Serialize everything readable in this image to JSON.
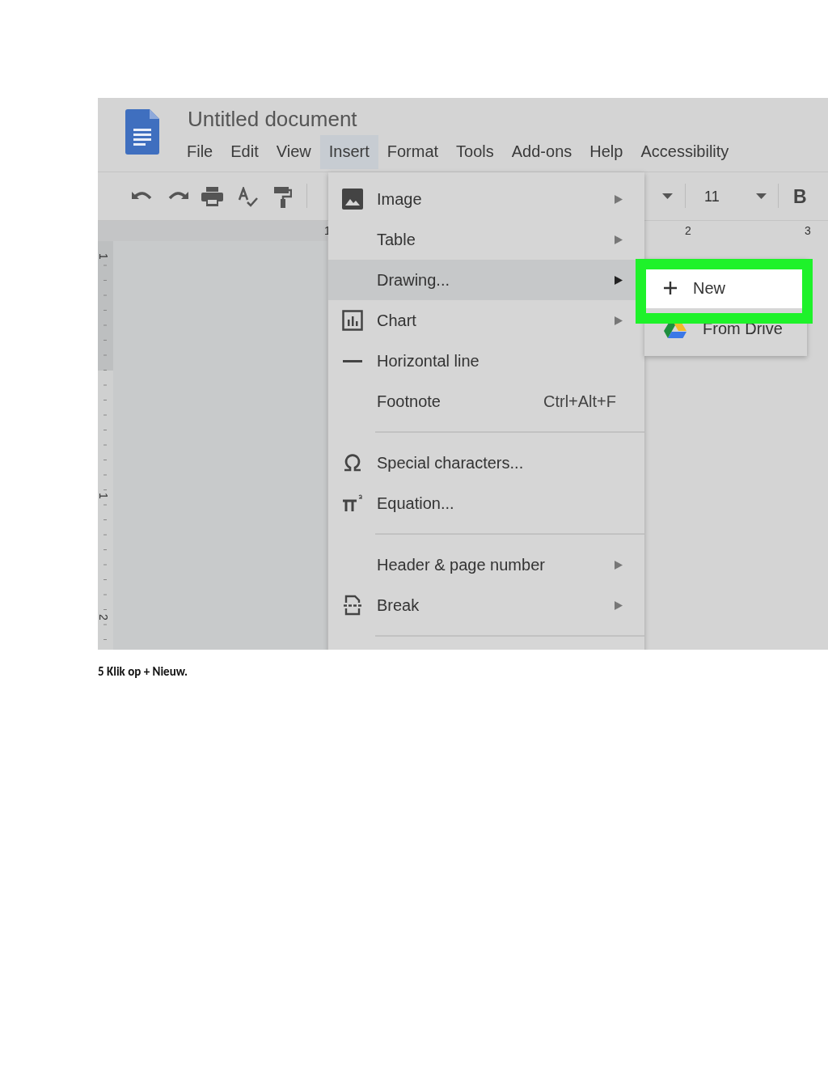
{
  "document_window": {
    "title": "Untitled document",
    "menu_bar": [
      {
        "label": "File",
        "selected": false
      },
      {
        "label": "Edit",
        "selected": false
      },
      {
        "label": "View",
        "selected": false
      },
      {
        "label": "Insert",
        "selected": true
      },
      {
        "label": "Format",
        "selected": false
      },
      {
        "label": "Tools",
        "selected": false
      },
      {
        "label": "Add-ons",
        "selected": false
      },
      {
        "label": "Help",
        "selected": false
      },
      {
        "label": "Accessibility",
        "selected": false
      }
    ],
    "toolbar": {
      "font_size": "11",
      "bold_label": "B"
    },
    "horizontal_ruler": [
      "1",
      "2",
      "3"
    ],
    "vertical_ruler": [
      "1",
      "1",
      "2"
    ],
    "insert_menu": [
      {
        "kind": "item",
        "label": "Image",
        "submenu": true,
        "selected": false
      },
      {
        "kind": "item",
        "label": "Table",
        "submenu": true,
        "selected": false
      },
      {
        "kind": "item",
        "label": "Drawing...",
        "submenu": true,
        "selected": true
      },
      {
        "kind": "item",
        "label": "Chart",
        "submenu": true,
        "selected": false
      },
      {
        "kind": "item",
        "label": "Horizontal line",
        "submenu": false,
        "selected": false
      },
      {
        "kind": "item",
        "label": "Footnote",
        "shortcut": "Ctrl+Alt+F",
        "submenu": false,
        "selected": false
      },
      {
        "kind": "separator"
      },
      {
        "kind": "item",
        "label": "Special characters...",
        "submenu": false,
        "selected": false
      },
      {
        "kind": "item",
        "label": "Equation...",
        "submenu": false,
        "selected": false
      },
      {
        "kind": "separator"
      },
      {
        "kind": "item",
        "label": "Header & page number",
        "submenu": true,
        "selected": false
      },
      {
        "kind": "item",
        "label": "Break",
        "submenu": true,
        "selected": false
      },
      {
        "kind": "separator"
      }
    ],
    "drawing_submenu": [
      {
        "label": "New",
        "selected": true,
        "highlighted": true
      },
      {
        "label": "From Drive",
        "selected": false,
        "highlighted": false
      }
    ]
  },
  "caption": "5 Klik op + Nieuw."
}
